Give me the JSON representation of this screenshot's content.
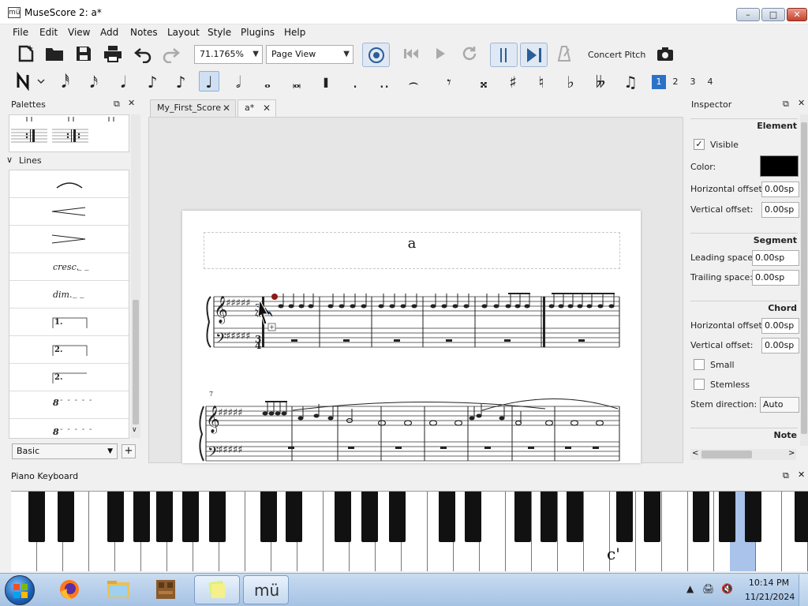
{
  "window": {
    "title": "MuseScore 2: a*",
    "app_icon": "mü",
    "minimize": "–",
    "maximize": "□",
    "close": "✕"
  },
  "menu": [
    "File",
    "Edit",
    "View",
    "Add",
    "Notes",
    "Layout",
    "Style",
    "Plugins",
    "Help"
  ],
  "toolbar": {
    "zoom": "71.1765%",
    "view_mode": "Page View",
    "concert_pitch": "Concert Pitch",
    "icons": [
      "new-file-icon",
      "open-folder-icon",
      "save-icon",
      "print-icon",
      "undo-icon",
      "redo-icon",
      "mixer-icon",
      "rewind-icon",
      "play-icon",
      "loop-icon",
      "play-repeats-icon",
      "pan-icon",
      "metronome-icon",
      "camera-icon"
    ]
  },
  "note_input": {
    "voices": [
      "1",
      "2",
      "3",
      "4"
    ],
    "active_voice": "1"
  },
  "palettes": {
    "title": "Palettes",
    "section": "Lines",
    "line_items": [
      "cresc.",
      "dim.",
      "1.",
      "2.",
      "2.",
      "8",
      "8"
    ],
    "workspace": "Basic",
    "add": "+"
  },
  "tabs": [
    {
      "label": "My_First_Score",
      "close": "✕"
    },
    {
      "label": "a*",
      "close": "✕"
    }
  ],
  "score": {
    "title": "a",
    "measure_number": "7"
  },
  "inspector": {
    "title": "Inspector",
    "element": {
      "header": "Element",
      "visible_label": "Visible",
      "visible": true,
      "color_label": "Color:",
      "color": "#000000",
      "h_offset_label": "Horizontal offset:",
      "h_offset": "0.00sp",
      "v_offset_label": "Vertical offset:",
      "v_offset": "0.00sp"
    },
    "segment": {
      "header": "Segment",
      "leading_label": "Leading space:",
      "leading": "0.00sp",
      "trailing_label": "Trailing space:",
      "trailing": "0.00sp"
    },
    "chord": {
      "header": "Chord",
      "h_offset_label": "Horizontal offset:",
      "h_offset": "0.00sp",
      "v_offset_label": "Vertical offset:",
      "v_offset": "0.00sp",
      "small_label": "Small",
      "stemless_label": "Stemless",
      "stem_dir_label": "Stem direction:",
      "stem_dir": "Auto"
    },
    "note": {
      "header": "Note"
    }
  },
  "piano": {
    "title": "Piano Keyboard",
    "key_label": "c'",
    "highlight_color": "#a9c3ea"
  },
  "taskbar": {
    "time": "10:14 PM",
    "date": "11/21/2024"
  }
}
